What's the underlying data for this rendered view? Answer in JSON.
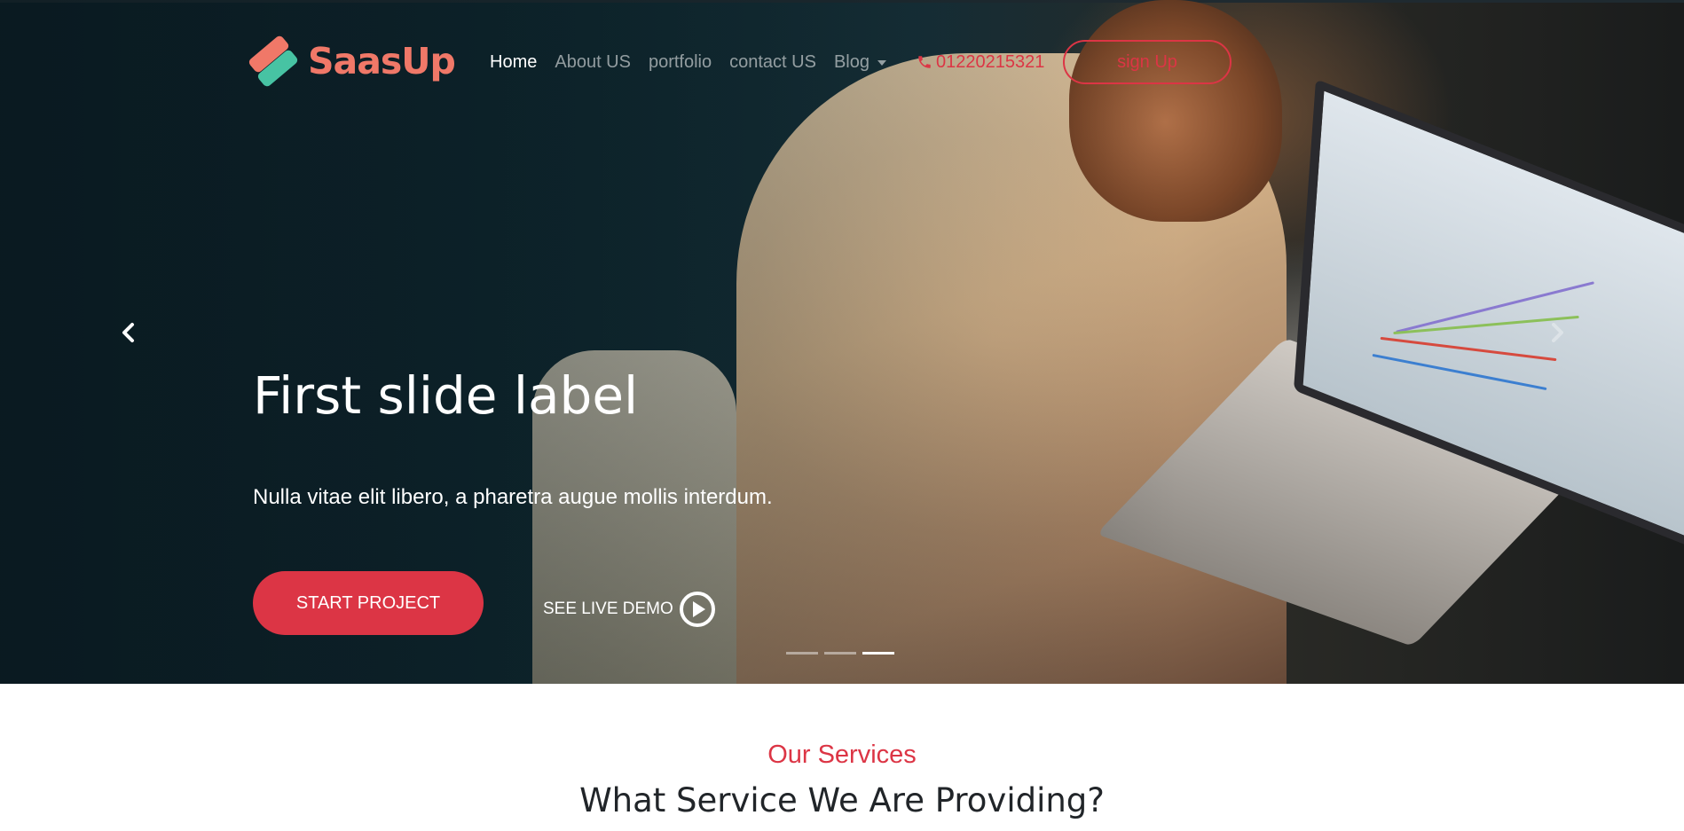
{
  "brand": {
    "name": "SaasUp",
    "colors": {
      "primary": "#dc3545",
      "logo_coral": "#f07868",
      "logo_teal": "#47c3a3"
    }
  },
  "nav": {
    "links": [
      {
        "label": "Home",
        "active": true
      },
      {
        "label": "About US",
        "active": false
      },
      {
        "label": "portfolio",
        "active": false
      },
      {
        "label": "contact US",
        "active": false
      }
    ],
    "blog_label": "Blog",
    "phone": "01220215321",
    "phone_icon": "phone-icon",
    "signup_label": "sign Up"
  },
  "carousel": {
    "caption_title": "First slide label",
    "caption_text": "Nulla vitae elit libero, a pharetra augue mollis interdum.",
    "start_label": "START PROJECT",
    "demo_label": "SEE LIVE DEMO",
    "prev_icon": "chevron-left-icon",
    "next_icon": "chevron-right-icon",
    "slide_count": 3,
    "active_slide": 3
  },
  "services": {
    "kicker": "Our Services",
    "title": "What Service We Are Providing?"
  }
}
